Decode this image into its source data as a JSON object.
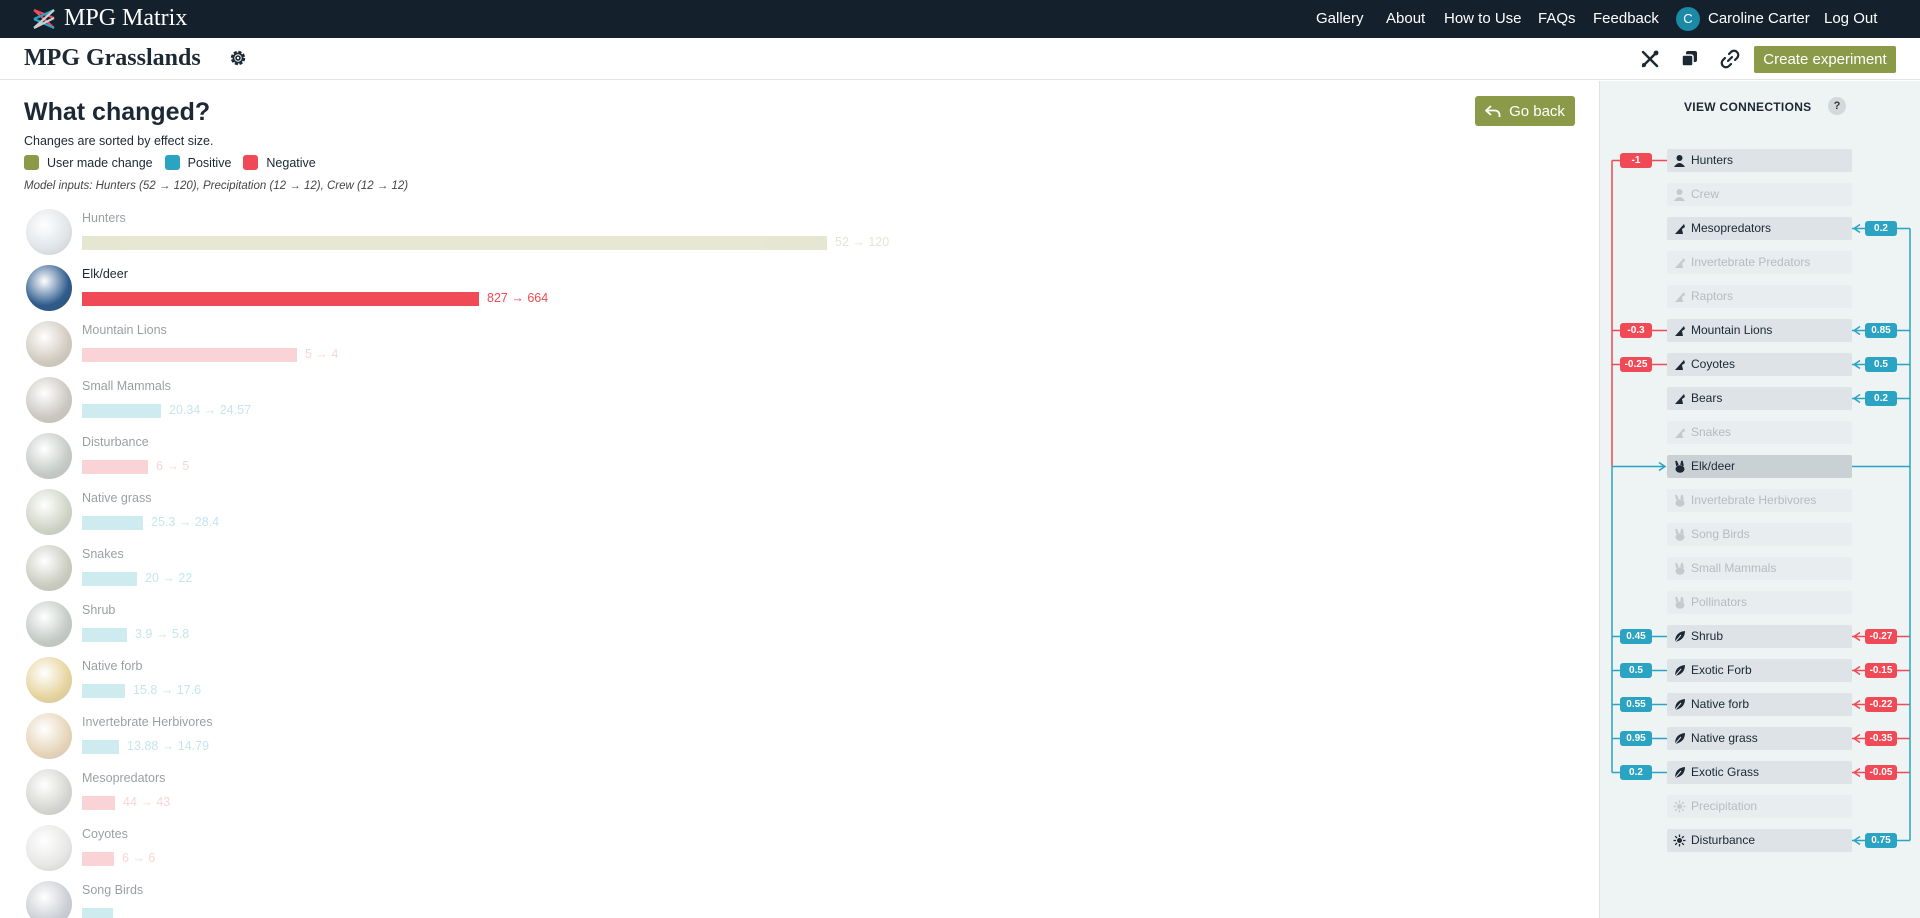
{
  "nav": {
    "brand": "MPG Matrix",
    "links": [
      "Gallery",
      "About",
      "How to Use",
      "FAQs",
      "Feedback"
    ],
    "user_initial": "C",
    "user_name": "Caroline Carter",
    "logout": "Log Out"
  },
  "project": {
    "title": "MPG Grasslands",
    "create_label": "Create experiment"
  },
  "main": {
    "heading": "What changed?",
    "subtitle": "Changes are sorted by effect size.",
    "legend": [
      {
        "label": "User made change",
        "color": "#8b9a48"
      },
      {
        "label": "Positive",
        "color": "#2ba3c2"
      },
      {
        "label": "Negative",
        "color": "#ef4a55"
      }
    ],
    "model_inputs": "Model inputs: Hunters (52 → 120), Precipitation (12 → 12), Crew (12 → 12)",
    "go_back": "Go back",
    "changes": [
      {
        "name": "Hunters",
        "from": "52",
        "to": "120",
        "kind": "user",
        "bar_fraction": 0.745,
        "faded": true,
        "photo": "#b9c4cc"
      },
      {
        "name": "Elk/deer",
        "from": "827",
        "to": "664",
        "kind": "neg",
        "bar_fraction": 0.397,
        "faded": false,
        "photo": "#2d5b8c"
      },
      {
        "name": "Mountain Lions",
        "from": "5",
        "to": "4",
        "kind": "neg",
        "bar_fraction": 0.215,
        "faded": true,
        "photo": "#9a8a72"
      },
      {
        "name": "Small Mammals",
        "from": "20.34",
        "to": "24.57",
        "kind": "pos",
        "bar_fraction": 0.079,
        "faded": true,
        "photo": "#8e8576"
      },
      {
        "name": "Disturbance",
        "from": "6",
        "to": "5",
        "kind": "neg",
        "bar_fraction": 0.066,
        "faded": true,
        "photo": "#7f8c82"
      },
      {
        "name": "Native grass",
        "from": "25.3",
        "to": "28.4",
        "kind": "pos",
        "bar_fraction": 0.061,
        "faded": true,
        "photo": "#95a080"
      },
      {
        "name": "Snakes",
        "from": "20",
        "to": "22",
        "kind": "pos",
        "bar_fraction": 0.055,
        "faded": true,
        "photo": "#8a8f74"
      },
      {
        "name": "Shrub",
        "from": "3.9",
        "to": "5.8",
        "kind": "pos",
        "bar_fraction": 0.045,
        "faded": true,
        "photo": "#7c8a80"
      },
      {
        "name": "Native forb",
        "from": "15.8",
        "to": "17.6",
        "kind": "pos",
        "bar_fraction": 0.043,
        "faded": true,
        "photo": "#c8a028"
      },
      {
        "name": "Invertebrate Herbivores",
        "from": "13.88",
        "to": "14.79",
        "kind": "pos",
        "bar_fraction": 0.037,
        "faded": true,
        "photo": "#c9a265"
      },
      {
        "name": "Mesopredators",
        "from": "44",
        "to": "43",
        "kind": "neg",
        "bar_fraction": 0.033,
        "faded": true,
        "photo": "#a4a49a"
      },
      {
        "name": "Coyotes",
        "from": "6",
        "to": "6",
        "kind": "neg",
        "bar_fraction": 0.032,
        "faded": true,
        "photo": "#c9cac6"
      },
      {
        "name": "Song Birds",
        "from": "",
        "to": "",
        "kind": "pos",
        "bar_fraction": 0.031,
        "faded": true,
        "photo": "#8b93a2"
      }
    ]
  },
  "sidebar": {
    "title": "VIEW CONNECTIONS",
    "help": "?",
    "nodes": [
      {
        "name": "Hunters",
        "icon": "person",
        "dim": false,
        "left": {
          "value": "-1",
          "sign": "neg"
        },
        "right": null
      },
      {
        "name": "Crew",
        "icon": "person",
        "dim": true,
        "left": null,
        "right": null
      },
      {
        "name": "Mesopredators",
        "icon": "predator",
        "dim": false,
        "left": null,
        "right": {
          "value": "0.2",
          "sign": "pos"
        }
      },
      {
        "name": "Invertebrate Predators",
        "icon": "predator",
        "dim": true,
        "left": null,
        "right": null
      },
      {
        "name": "Raptors",
        "icon": "predator",
        "dim": true,
        "left": null,
        "right": null
      },
      {
        "name": "Mountain Lions",
        "icon": "predator",
        "dim": false,
        "left": {
          "value": "-0.3",
          "sign": "neg"
        },
        "right": {
          "value": "0.85",
          "sign": "pos"
        }
      },
      {
        "name": "Coyotes",
        "icon": "predator",
        "dim": false,
        "left": {
          "value": "-0.25",
          "sign": "neg"
        },
        "right": {
          "value": "0.5",
          "sign": "pos"
        }
      },
      {
        "name": "Bears",
        "icon": "predator",
        "dim": false,
        "left": null,
        "right": {
          "value": "0.2",
          "sign": "pos"
        }
      },
      {
        "name": "Snakes",
        "icon": "predator",
        "dim": true,
        "left": null,
        "right": null
      },
      {
        "name": "Elk/deer",
        "icon": "herbivore",
        "dim": false,
        "selected": true,
        "left": null,
        "right": null
      },
      {
        "name": "Invertebrate Herbivores",
        "icon": "herbivore",
        "dim": true,
        "left": null,
        "right": null
      },
      {
        "name": "Song Birds",
        "icon": "herbivore",
        "dim": true,
        "left": null,
        "right": null
      },
      {
        "name": "Small Mammals",
        "icon": "herbivore",
        "dim": true,
        "left": null,
        "right": null
      },
      {
        "name": "Pollinators",
        "icon": "herbivore",
        "dim": true,
        "left": null,
        "right": null
      },
      {
        "name": "Shrub",
        "icon": "leaf",
        "dim": false,
        "left": {
          "value": "0.45",
          "sign": "pos"
        },
        "right": {
          "value": "-0.27",
          "sign": "neg"
        }
      },
      {
        "name": "Exotic Forb",
        "icon": "leaf",
        "dim": false,
        "left": {
          "value": "0.5",
          "sign": "pos"
        },
        "right": {
          "value": "-0.15",
          "sign": "neg"
        }
      },
      {
        "name": "Native forb",
        "icon": "leaf",
        "dim": false,
        "left": {
          "value": "0.55",
          "sign": "pos"
        },
        "right": {
          "value": "-0.22",
          "sign": "neg"
        }
      },
      {
        "name": "Native grass",
        "icon": "leaf",
        "dim": false,
        "left": {
          "value": "0.95",
          "sign": "pos"
        },
        "right": {
          "value": "-0.35",
          "sign": "neg"
        }
      },
      {
        "name": "Exotic Grass",
        "icon": "leaf",
        "dim": false,
        "left": {
          "value": "0.2",
          "sign": "pos"
        },
        "right": {
          "value": "-0.05",
          "sign": "neg"
        }
      },
      {
        "name": "Precipitation",
        "icon": "sun",
        "dim": true,
        "left": null,
        "right": null
      },
      {
        "name": "Disturbance",
        "icon": "sun",
        "dim": false,
        "left": null,
        "right": {
          "value": "0.75",
          "sign": "pos"
        }
      }
    ]
  },
  "colors": {
    "user": "#c8cc9c",
    "neg": "#ef4a55",
    "neg_faded": "#f6a0a6",
    "pos": "#94d3df",
    "pos_text": "#7cc6d6",
    "user_text": "#c2c6a2"
  }
}
